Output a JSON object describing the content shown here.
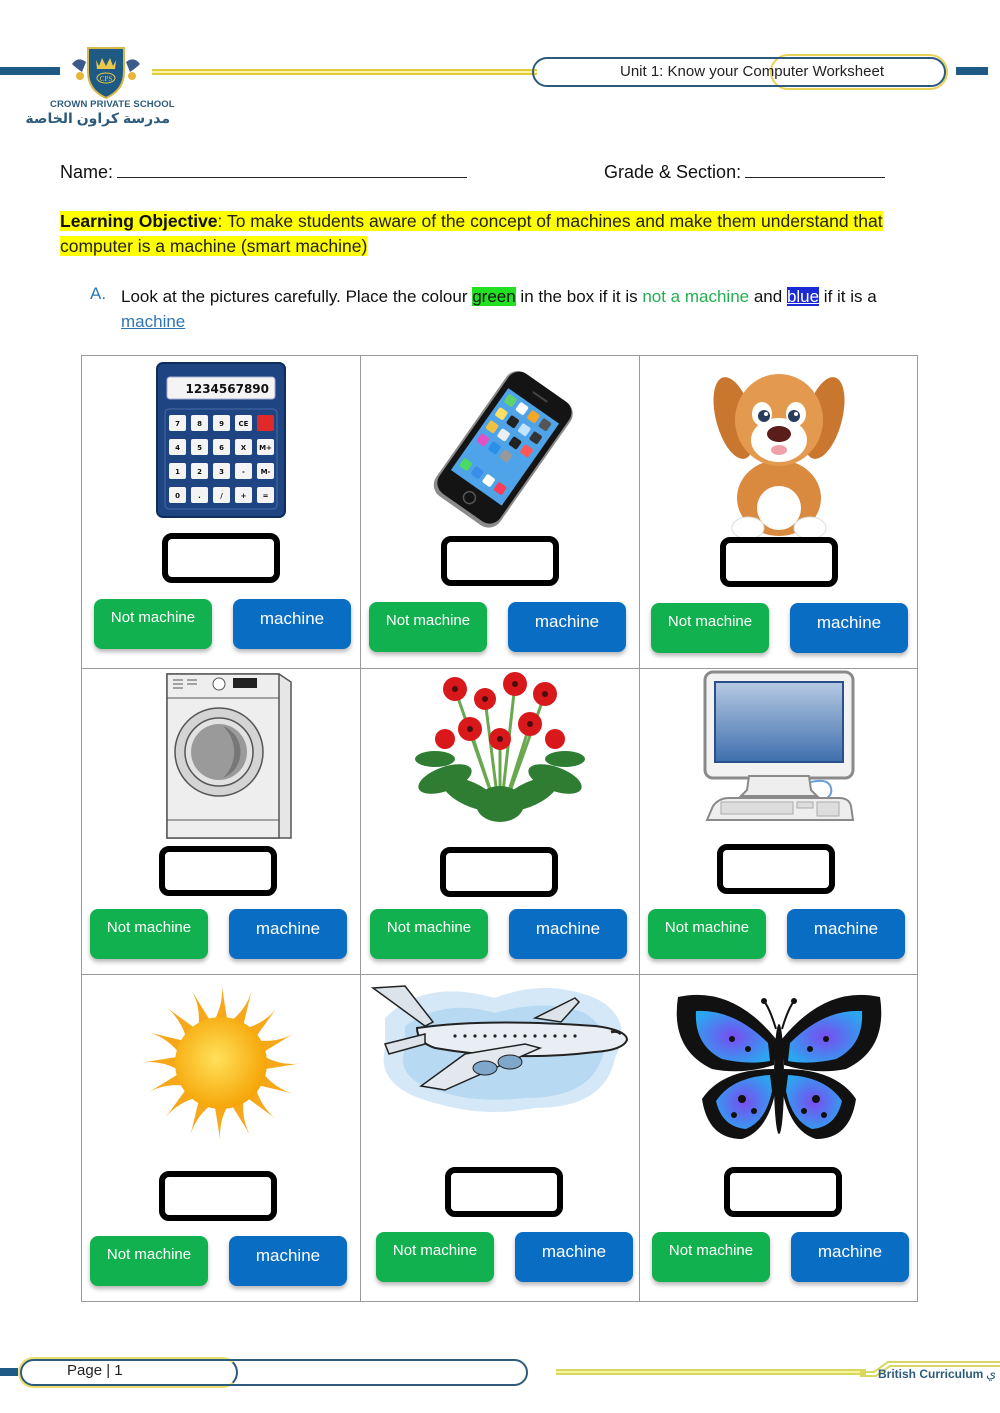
{
  "header": {
    "school_name_en": "CROWN PRIVATE SCHOOL",
    "school_name_ar": "مدرسة كراون الخاصة",
    "logo_text": "CPS",
    "worksheet_title": "Unit 1: Know your Computer Worksheet"
  },
  "fields": {
    "name_label": "Name:",
    "grade_label": "Grade & Section:"
  },
  "objective": {
    "label": "Learning Objective",
    "text": ": To make students aware of the concept of machines and make them understand that computer is a machine (smart machine)"
  },
  "instruction": {
    "letter": "A.",
    "part1": "Look at the pictures carefully. Place the colour ",
    "green_word": "green",
    "part2": " in the box if it is ",
    "not_machine_phrase": "not a machine",
    "part3": " and ",
    "blue_word": "blue",
    "part4": " if it is a ",
    "machine_word": "machine"
  },
  "colors": {
    "not_machine": "#12b14f",
    "machine": "#0a6dc4",
    "brand_navy": "#1f5a85",
    "brand_gold": "#e6cc3a"
  },
  "items": [
    {
      "picture": "calculator",
      "display": "1234567890",
      "not_label": "Not machine",
      "yes_label": "machine"
    },
    {
      "picture": "smartphone",
      "not_label": "Not machine",
      "yes_label": "machine"
    },
    {
      "picture": "puppy",
      "not_label": "Not machine",
      "yes_label": "machine"
    },
    {
      "picture": "washing-machine",
      "not_label": "Not machine",
      "yes_label": "machine"
    },
    {
      "picture": "flowers",
      "not_label": "Not machine",
      "yes_label": "machine"
    },
    {
      "picture": "desktop-computer",
      "not_label": "Not machine",
      "yes_label": "machine"
    },
    {
      "picture": "sun",
      "not_label": "Not machine",
      "yes_label": "machine"
    },
    {
      "picture": "airplane",
      "not_label": "Not machine",
      "yes_label": "machine"
    },
    {
      "picture": "butterfly",
      "not_label": "Not machine",
      "yes_label": "machine"
    }
  ],
  "footer": {
    "page_label": "Page | 1",
    "curriculum": "British Curriculum",
    "arabic_glyph": "ي"
  }
}
